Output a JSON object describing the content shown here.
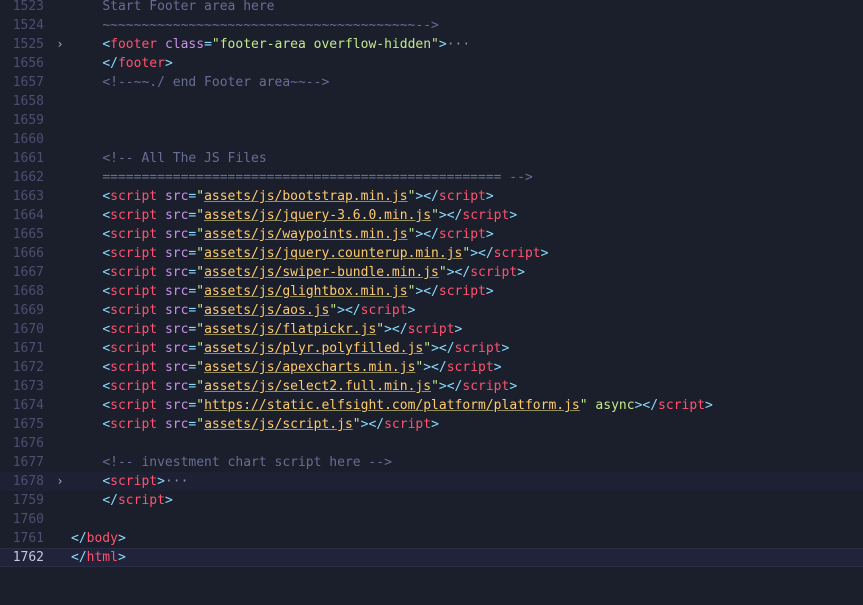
{
  "lines": [
    {
      "n": "1523",
      "fold": "",
      "indent": 1,
      "tokens": [
        [
          "c",
          "Start Footer area here"
        ]
      ]
    },
    {
      "n": "1524",
      "fold": "",
      "indent": 1,
      "tokens": [
        [
          "c",
          "~~~~~~~~~~~~~~~~~~~~~~~~~~~~~~~~~~~~~~~~-->"
        ]
      ]
    },
    {
      "n": "1525",
      "fold": "›",
      "indent": 1,
      "tokens": [
        [
          "p",
          "<"
        ],
        [
          "n",
          "footer"
        ],
        [
          "s",
          " "
        ],
        [
          "a",
          "class"
        ],
        [
          "p",
          "="
        ],
        [
          "q",
          "\"footer-area overflow-hidden\""
        ],
        [
          "p",
          ">"
        ],
        [
          "e",
          "···"
        ]
      ]
    },
    {
      "n": "1656",
      "fold": "",
      "indent": 1,
      "tokens": [
        [
          "p",
          "</"
        ],
        [
          "n",
          "footer"
        ],
        [
          "p",
          ">"
        ]
      ]
    },
    {
      "n": "1657",
      "fold": "",
      "indent": 1,
      "tokens": [
        [
          "c",
          "<!--~~./ end Footer area~~-->"
        ]
      ]
    },
    {
      "n": "1658",
      "fold": "",
      "indent": 0,
      "tokens": []
    },
    {
      "n": "1659",
      "fold": "",
      "indent": 0,
      "tokens": []
    },
    {
      "n": "1660",
      "fold": "",
      "indent": 0,
      "tokens": []
    },
    {
      "n": "1661",
      "fold": "",
      "indent": 1,
      "tokens": [
        [
          "c",
          "<!-- All The JS Files"
        ]
      ]
    },
    {
      "n": "1662",
      "fold": "",
      "indent": 1,
      "tokens": [
        [
          "c",
          "=================================================== -->"
        ]
      ]
    },
    {
      "n": "1663",
      "fold": "",
      "indent": 1,
      "script": "assets/js/bootstrap.min.js"
    },
    {
      "n": "1664",
      "fold": "",
      "indent": 1,
      "script": "assets/js/jquery-3.6.0.min.js"
    },
    {
      "n": "1665",
      "fold": "",
      "indent": 1,
      "script": "assets/js/waypoints.min.js"
    },
    {
      "n": "1666",
      "fold": "",
      "indent": 1,
      "script": "assets/js/jquery.counterup.min.js"
    },
    {
      "n": "1667",
      "fold": "",
      "indent": 1,
      "script": "assets/js/swiper-bundle.min.js"
    },
    {
      "n": "1668",
      "fold": "",
      "indent": 1,
      "script": "assets/js/glightbox.min.js"
    },
    {
      "n": "1669",
      "fold": "",
      "indent": 1,
      "script": "assets/js/aos.js"
    },
    {
      "n": "1670",
      "fold": "",
      "indent": 1,
      "script": "assets/js/flatpickr.js"
    },
    {
      "n": "1671",
      "fold": "",
      "indent": 1,
      "script": "assets/js/plyr.polyfilled.js"
    },
    {
      "n": "1672",
      "fold": "",
      "indent": 1,
      "script": "assets/js/apexcharts.min.js"
    },
    {
      "n": "1673",
      "fold": "",
      "indent": 1,
      "script": "assets/js/select2.full.min.js"
    },
    {
      "n": "1674",
      "fold": "",
      "indent": 1,
      "script": "https://static.elfsight.com/platform/platform.js",
      "async": "async"
    },
    {
      "n": "1675",
      "fold": "",
      "indent": 1,
      "script": "assets/js/script.js"
    },
    {
      "n": "1676",
      "fold": "",
      "indent": 0,
      "tokens": []
    },
    {
      "n": "1677",
      "fold": "",
      "indent": 1,
      "tokens": [
        [
          "c",
          "<!-- investment chart script here -->"
        ]
      ]
    },
    {
      "n": "1678",
      "fold": "›",
      "indent": 1,
      "hl": true,
      "tokens": [
        [
          "p",
          "<"
        ],
        [
          "n",
          "script"
        ],
        [
          "p",
          ">"
        ],
        [
          "e",
          "···"
        ]
      ]
    },
    {
      "n": "1759",
      "fold": "",
      "indent": 1,
      "tokens": [
        [
          "p",
          "</"
        ],
        [
          "n",
          "script"
        ],
        [
          "p",
          ">"
        ]
      ]
    },
    {
      "n": "1760",
      "fold": "",
      "indent": 0,
      "tokens": []
    },
    {
      "n": "1761",
      "fold": "",
      "indent": 0,
      "tokens": [
        [
          "p",
          "</"
        ],
        [
          "n",
          "body"
        ],
        [
          "p",
          ">"
        ]
      ]
    },
    {
      "n": "1762",
      "fold": "",
      "indent": 0,
      "current": true,
      "tokens": [
        [
          "p",
          "</"
        ],
        [
          "n",
          "html"
        ],
        [
          "p",
          ">"
        ]
      ]
    }
  ]
}
